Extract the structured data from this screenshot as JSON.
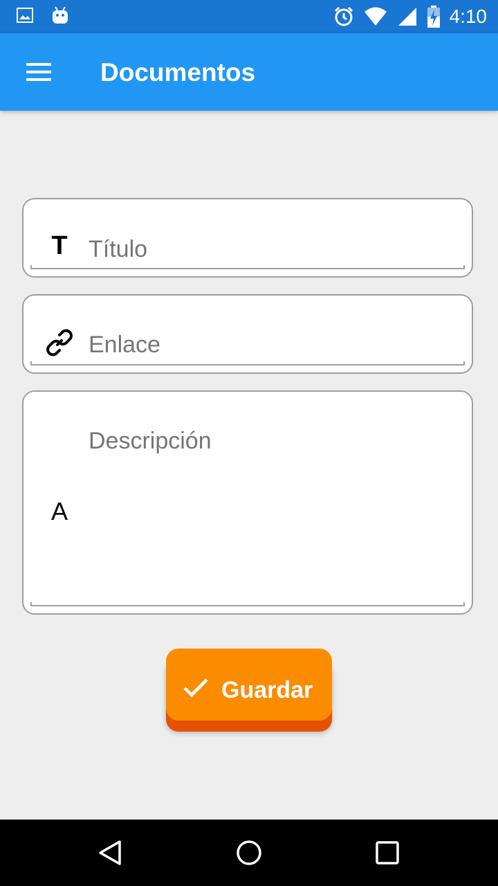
{
  "status_bar": {
    "time": "4:10",
    "icons": [
      "image-icon",
      "android-icon",
      "alarm-icon",
      "wifi-icon",
      "signal-icon",
      "battery-charging-icon"
    ]
  },
  "app_bar": {
    "title": "Documentos",
    "menu_icon": "menu-icon"
  },
  "form": {
    "title_field": {
      "icon": "T",
      "placeholder": "Título"
    },
    "link_field": {
      "icon": "link-icon",
      "placeholder": "Enlace"
    },
    "description_field": {
      "icon": "A",
      "placeholder": "Descripción"
    }
  },
  "save_button": {
    "label": "Guardar",
    "icon": "check-icon"
  },
  "colors": {
    "status_bar": "#1976d2",
    "app_bar": "#2196f3",
    "background": "#eeeeee",
    "button": "#fb8c00",
    "button_shadow": "#e65100"
  },
  "nav_bar": {
    "icons": [
      "back-icon",
      "home-icon",
      "recents-icon"
    ]
  }
}
